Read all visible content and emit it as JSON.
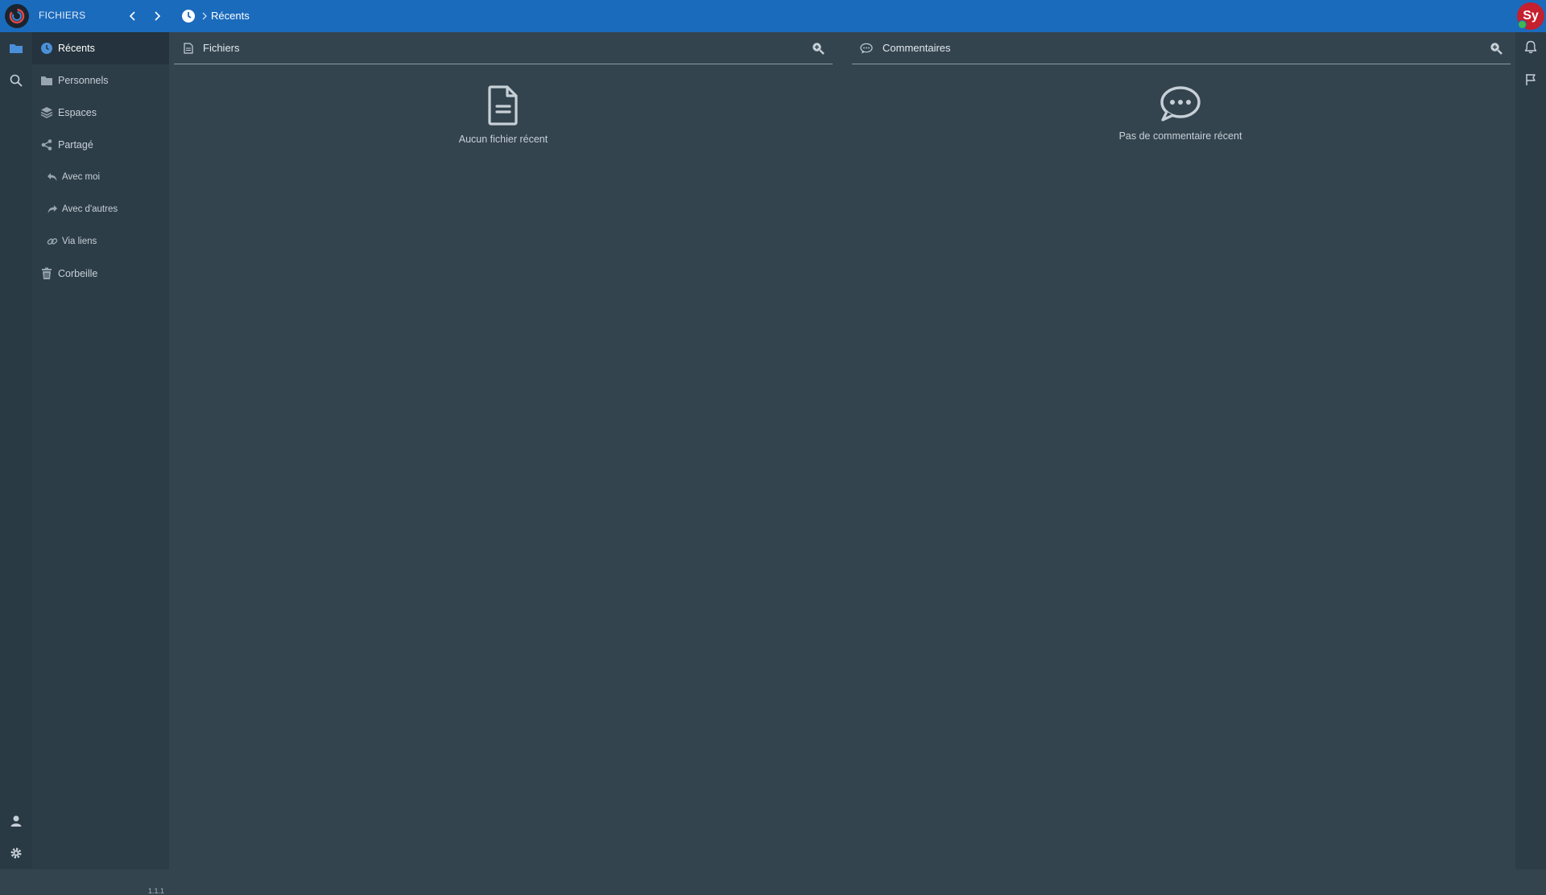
{
  "app": {
    "name": "FICHIERS",
    "version": "1.1.1"
  },
  "breadcrumb": {
    "current": "Récents"
  },
  "user": {
    "avatar_initials": "Sy",
    "avatar_color": "#c4202e",
    "status_color": "#3fb950"
  },
  "colors": {
    "topbar": "#1b6bbd",
    "sidebar": "#2d3d48",
    "main": "#34444f"
  },
  "sidebar": {
    "items": [
      {
        "label": "Récents",
        "icon": "clock-icon",
        "active": true
      },
      {
        "label": "Personnels",
        "icon": "folder-icon"
      },
      {
        "label": "Espaces",
        "icon": "layers-icon"
      },
      {
        "label": "Partagé",
        "icon": "share-icon"
      },
      {
        "label": "Avec moi",
        "icon": "reply-icon",
        "sub": true
      },
      {
        "label": "Avec d'autres",
        "icon": "forward-icon",
        "sub": true
      },
      {
        "label": "Via liens",
        "icon": "link-icon",
        "sub": true
      },
      {
        "label": "Corbeille",
        "icon": "trash-icon"
      }
    ]
  },
  "panels": {
    "files": {
      "title": "Fichiers",
      "empty_message": "Aucun fichier récent"
    },
    "comments": {
      "title": "Commentaires",
      "empty_message": "Pas de commentaire récent"
    }
  }
}
